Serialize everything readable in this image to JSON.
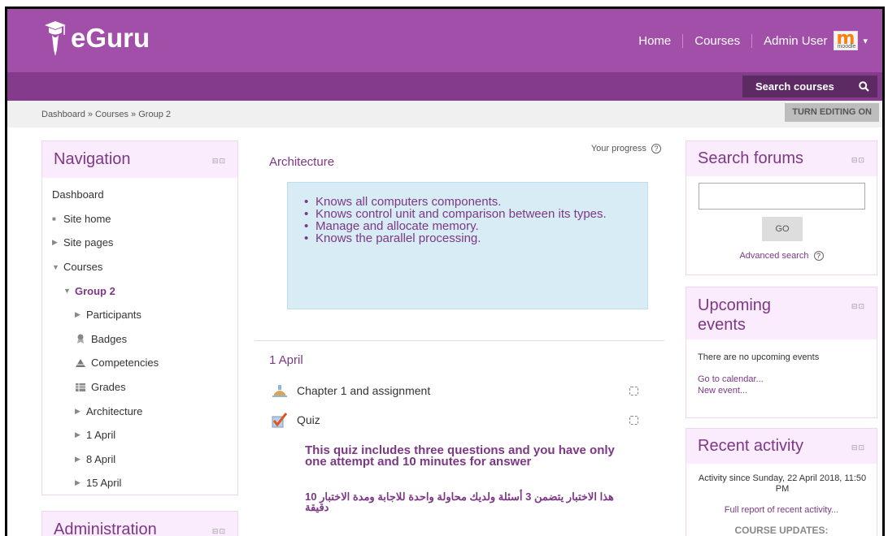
{
  "header": {
    "brand": "eGuru",
    "nav": [
      "Home",
      "Courses"
    ],
    "user": "Admin User",
    "avatar_text": "moodle"
  },
  "search_courses": {
    "label": "Search courses"
  },
  "breadcrumb": "Dashboard » Courses » Group 2",
  "edit_button": "TURN EDITING ON",
  "navigation": {
    "title": "Navigation",
    "items": [
      {
        "label": "Dashboard",
        "icon": "none"
      },
      {
        "label": "Site home",
        "icon": "bullet"
      },
      {
        "label": "Site pages",
        "icon": "triangle-right"
      },
      {
        "label": "Courses",
        "icon": "triangle-down"
      },
      {
        "label": "Group 2",
        "icon": "triangle-down"
      },
      {
        "label": "Participants",
        "icon": "triangle-right"
      },
      {
        "label": "Badges",
        "icon": "badge-icon"
      },
      {
        "label": "Competencies",
        "icon": "competency-icon"
      },
      {
        "label": "Grades",
        "icon": "grades-icon"
      },
      {
        "label": "Architecture",
        "icon": "triangle-right"
      },
      {
        "label": "1 April",
        "icon": "triangle-right"
      },
      {
        "label": "8 April",
        "icon": "triangle-right"
      },
      {
        "label": "15 April",
        "icon": "triangle-right"
      }
    ]
  },
  "administration": {
    "title": "Administration"
  },
  "course": {
    "progress_label": "Your progress",
    "section0_title": "Architecture",
    "outcomes": [
      "Knows all computers components.",
      "Knows control unit and comparison between its types.",
      "Manage and allocate memory.",
      "Knows the parallel processing."
    ],
    "section1_title": "1 April",
    "activities": [
      {
        "label": "Chapter 1 and assignment",
        "icon": "assignment-icon"
      },
      {
        "label": "Quiz",
        "icon": "quiz-icon"
      }
    ],
    "quiz_note_en": "This quiz includes three questions and you have only one attempt and 10 minutes for answer",
    "quiz_note_ar": "هذا الاختبار يتضمن 3 أسئلة ولديك محاولة واحدة للاجابة ومدة الاختبار 10 دقيقة"
  },
  "search_forums": {
    "title": "Search forums",
    "go_label": "GO",
    "advanced": "Advanced search"
  },
  "upcoming": {
    "title": "Upcoming events",
    "empty": "There are no upcoming events",
    "calendar_link": "Go to calendar...",
    "new_event": "New event..."
  },
  "recent": {
    "title": "Recent activity",
    "since": "Activity since Sunday, 22 April 2018, 11:50 PM",
    "full_report": "Full report of recent activity...",
    "updates": "COURSE UPDATES:"
  },
  "colors": {
    "header": "#a14fa8",
    "subbar": "#843b8b",
    "accent": "#7c3785",
    "block_head": "#fbecfd",
    "summary_bg": "#d8ecf5"
  }
}
